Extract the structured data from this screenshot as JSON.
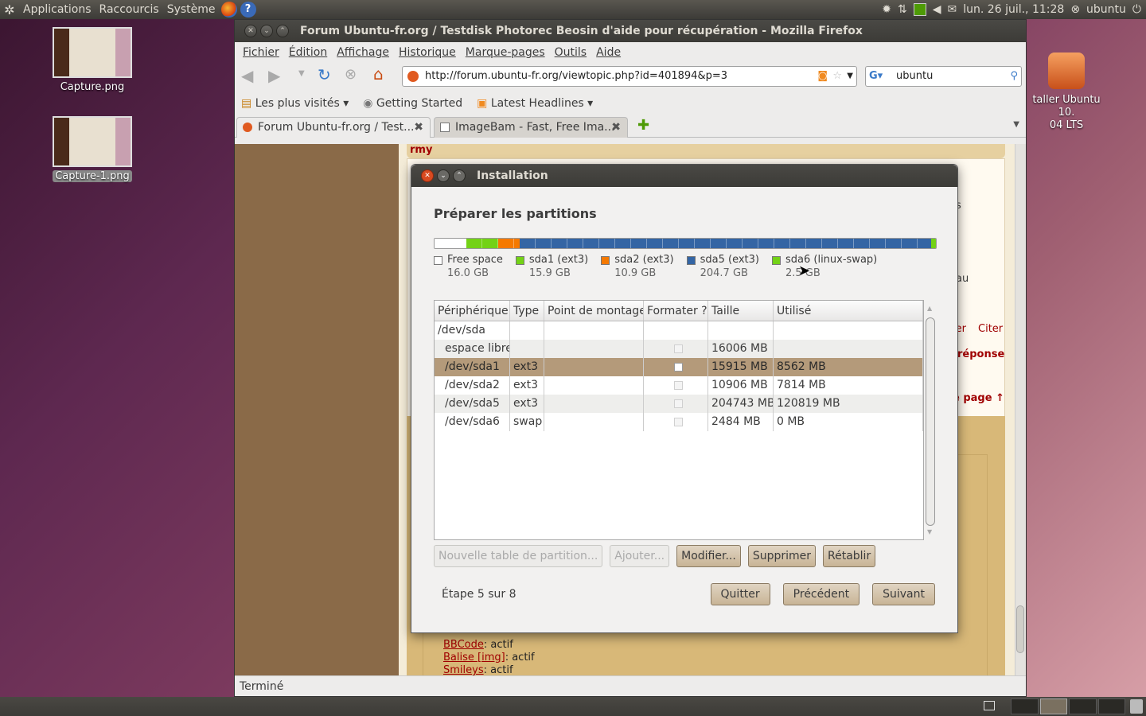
{
  "top_panel": {
    "menus": [
      "Applications",
      "Raccourcis",
      "Système"
    ],
    "datetime": "lun. 26 juil., 11:28",
    "user": "ubuntu"
  },
  "desktop": {
    "icons": [
      {
        "label": "Capture.png"
      },
      {
        "label": "Capture-1.png"
      }
    ],
    "installer_label": "taller Ubuntu 10.\n04 LTS"
  },
  "firefox": {
    "title": "Forum Ubuntu-fr.org / Testdisk Photorec Beosin d'aide pour récupération - Mozilla Firefox",
    "menu": [
      "Fichier",
      "Édition",
      "Affichage",
      "Historique",
      "Marque-pages",
      "Outils",
      "Aide"
    ],
    "url": "http://forum.ubuntu-fr.org/viewtopic.php?id=401894&p=3",
    "search": "ubuntu",
    "bookmarks": [
      "Les plus visités ▾",
      "Getting Started",
      "Latest Headlines ▾"
    ],
    "tabs": [
      {
        "label": "Forum Ubuntu-fr.org / Test..."
      },
      {
        "label": "ImageBam - Fast, Free Ima..."
      }
    ],
    "status": "Terminé",
    "page": {
      "top_user": "rmy",
      "fragments": [
        "s",
        "au",
        "ler",
        "Citer",
        "réponse",
        "e page ↑"
      ],
      "footer": [
        {
          "link": "BBCode",
          "value": ": actif"
        },
        {
          "link": "Balise [img]",
          "value": ": actif"
        },
        {
          "link": "Smileys",
          "value": ": actif"
        }
      ]
    }
  },
  "installer": {
    "title": "Installation",
    "heading": "Préparer les partitions",
    "colors": {
      "free": "#ffffff",
      "sda1": "#73d216",
      "sda2": "#f57900",
      "sda5": "#3465a4",
      "sda6": "#73d216"
    },
    "legend": [
      {
        "name": "Free space",
        "size": "16.0 GB",
        "color": "#ffffff"
      },
      {
        "name": "sda1 (ext3)",
        "size": "15.9 GB",
        "color": "#73d216"
      },
      {
        "name": "sda2 (ext3)",
        "size": "10.9 GB",
        "color": "#f57900"
      },
      {
        "name": "sda5 (ext3)",
        "size": "204.7 GB",
        "color": "#3465a4"
      },
      {
        "name": "sda6 (linux-swap)",
        "size": "2.5 GB",
        "color": "#73d216"
      }
    ],
    "partition_fractions": [
      0.064,
      0.063,
      0.043,
      0.82,
      0.01
    ],
    "table": {
      "headers": [
        "Périphérique",
        "Type",
        "Point de montage",
        "Formater ?",
        "Taille",
        "Utilisé"
      ],
      "rows": [
        [
          "/dev/sda",
          "",
          "",
          "",
          "",
          ""
        ],
        [
          "espace libre",
          "",
          "",
          "",
          "16006 MB",
          ""
        ],
        [
          "/dev/sda1",
          "ext3",
          "",
          "",
          "15915 MB",
          "8562 MB"
        ],
        [
          "/dev/sda2",
          "ext3",
          "",
          "",
          "10906 MB",
          "7814 MB"
        ],
        [
          "/dev/sda5",
          "ext3",
          "",
          "",
          "204743 MB",
          "120819 MB"
        ],
        [
          "/dev/sda6",
          "swap",
          "",
          "",
          "2484 MB",
          "0 MB"
        ]
      ]
    },
    "buttons": [
      "Nouvelle table de partition...",
      "Ajouter...",
      "Modifier...",
      "Supprimer",
      "Rétablir"
    ],
    "step": "Étape 5 sur 8",
    "nav": [
      "Quitter",
      "Précédent",
      "Suivant"
    ]
  }
}
